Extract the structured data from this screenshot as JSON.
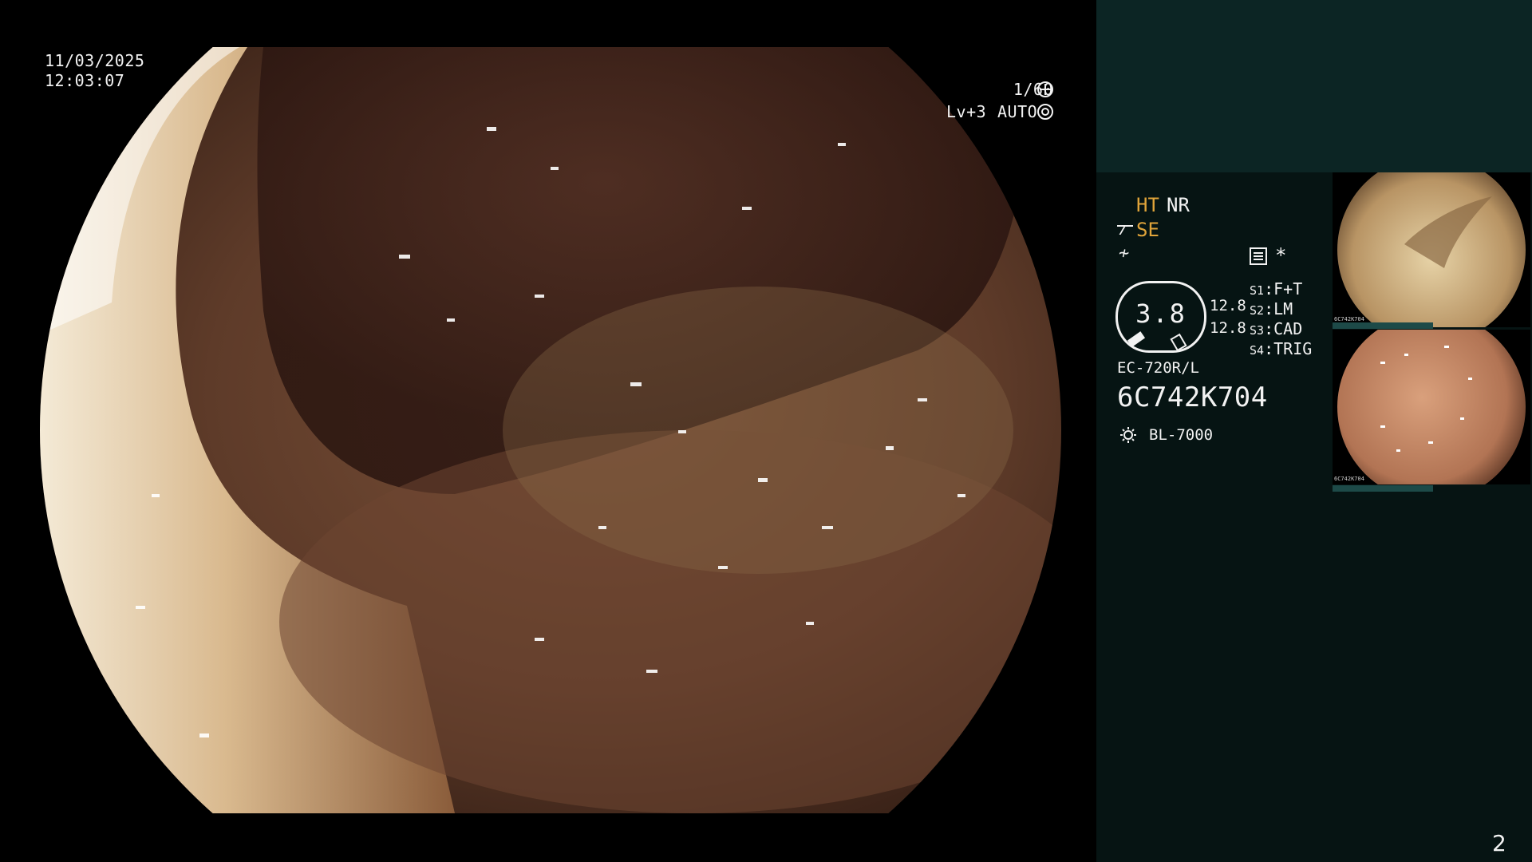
{
  "overlay": {
    "date": "11/03/2025",
    "time": "12:03:07",
    "shutter": "1/60",
    "level": "Lv+3",
    "iris_mode": "AUTO"
  },
  "panel": {
    "ht": "HT",
    "nr": "NR",
    "se": "SE",
    "bolt": "≁",
    "star": "*",
    "gauge_value": "3.8",
    "value_top": "12.8",
    "value_bottom": "12.8",
    "switches": [
      {
        "key": "S1",
        "value": "F+T"
      },
      {
        "key": "S2",
        "value": "LM"
      },
      {
        "key": "S3",
        "value": "CAD"
      },
      {
        "key": "S4",
        "value": "TRIG"
      }
    ],
    "scope_model": "EC-720R/L",
    "scope_serial": "6C742K704",
    "light_source": "BL-7000",
    "thumb_code": "6C742K704",
    "page_number": "2"
  },
  "colors": {
    "accent_orange": "#e0a43a",
    "panel_top": "#0c2524",
    "panel_body": "#061413"
  }
}
